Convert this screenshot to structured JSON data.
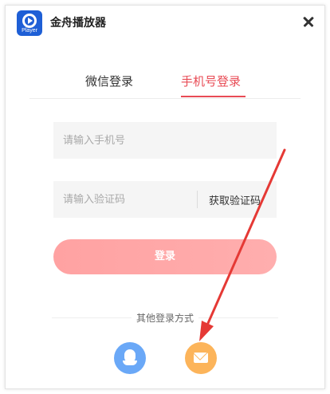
{
  "app": {
    "title": "金舟播放器",
    "logo_tag": "Player",
    "logo_color": "#1e5fd6"
  },
  "tabs": [
    {
      "label": "微信登录",
      "active": false
    },
    {
      "label": "手机号登录",
      "active": true
    }
  ],
  "form": {
    "phone_placeholder": "请输入手机号",
    "code_placeholder": "请输入验证码",
    "get_code_label": "获取验证码",
    "login_label": "登录"
  },
  "other_login": {
    "label": "其他登录方式",
    "methods": [
      {
        "icon": "qq-icon",
        "color": "#6aa8f7"
      },
      {
        "icon": "mail-icon",
        "color": "#fcb45a"
      }
    ]
  },
  "colors": {
    "accent": "#e84b55",
    "login_button": "#ffa6a6",
    "annotation_arrow": "#e53935"
  }
}
